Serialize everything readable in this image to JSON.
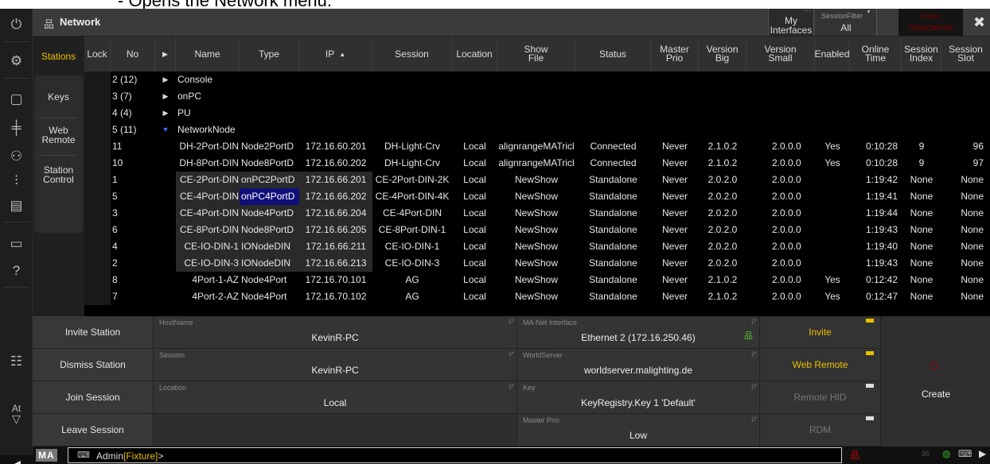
{
  "caption": {
    "text": "- Opens the Network menu."
  },
  "window": {
    "title": "Network",
    "icon": "network-icon"
  },
  "header": {
    "my_interfaces": "My Interfaces",
    "session_filter_label": "SessionFilter",
    "session_filter_value": "All",
    "status_label": "Status",
    "status_value": "Standalone"
  },
  "side": {
    "tab": "Stations",
    "items": [
      "Keys",
      "Web Remote",
      "Station Control"
    ]
  },
  "rail": {
    "at_label": "At"
  },
  "columns": {
    "stations": "Stations",
    "lock": "Lock",
    "no": "No",
    "name": "Name",
    "type": "Type",
    "ip": "IP",
    "session": "Session",
    "location": "Location",
    "show_file": "Show File",
    "status": "Status",
    "master_prio": "Master Prio",
    "version_big": "Version Big",
    "version_small": "Version Small",
    "enabled": "Enabled",
    "online_time": "Online Time",
    "session_index": "Session Index",
    "session_slot": "Session Slot"
  },
  "groups": [
    {
      "no": "2 (12)",
      "name": "Console",
      "expanded": false
    },
    {
      "no": "3 (7)",
      "name": "onPC",
      "expanded": false
    },
    {
      "no": "4 (4)",
      "name": "PU",
      "expanded": false
    },
    {
      "no": "5 (11)",
      "name": "NetworkNode",
      "expanded": true
    }
  ],
  "stations": [
    {
      "no": "11",
      "name": "DH-2Port-DIN",
      "type": "Node2PortD",
      "ip": "172.16.60.201",
      "session": "DH-Light-Crv",
      "location": "Local",
      "show": "alignrangeMATricl",
      "status": "Connected",
      "prio": "Never",
      "vbig": "2.1.0.2",
      "vsmall": "2.0.0.0",
      "enabled": "Yes",
      "online": "0:10:28",
      "sindex": "9",
      "sslot": "96",
      "shaded": false,
      "selected": false
    },
    {
      "no": "10",
      "name": "DH-8Port-DIN",
      "type": "Node8PortD",
      "ip": "172.16.60.202",
      "session": "DH-Light-Crv",
      "location": "Local",
      "show": "alignrangeMATricl",
      "status": "Connected",
      "prio": "Never",
      "vbig": "2.1.0.2",
      "vsmall": "2.0.0.0",
      "enabled": "Yes",
      "online": "0:10:28",
      "sindex": "9",
      "sslot": "97",
      "shaded": false,
      "selected": false
    },
    {
      "no": "1",
      "name": "CE-2Port-DIN",
      "type": "onPC2PortD",
      "ip": "172.16.66.201",
      "session": "CE-2Port-DIN-2K",
      "location": "Local",
      "show": "NewShow",
      "status": "Standalone",
      "prio": "Never",
      "vbig": "2.0.2.0",
      "vsmall": "2.0.0.0",
      "enabled": "",
      "online": "1:19:42",
      "sindex": "None",
      "sslot": "None",
      "shaded": true,
      "selected": false
    },
    {
      "no": "5",
      "name": "CE-4Port-DIN",
      "type": "onPC4PortD",
      "ip": "172.16.66.202",
      "session": "CE-4Port-DIN-4K",
      "location": "Local",
      "show": "NewShow",
      "status": "Standalone",
      "prio": "Never",
      "vbig": "2.0.2.0",
      "vsmall": "2.0.0.0",
      "enabled": "",
      "online": "1:19:41",
      "sindex": "None",
      "sslot": "None",
      "shaded": true,
      "selected": true
    },
    {
      "no": "3",
      "name": "CE-4Port-DIN",
      "type": "Node4PortD",
      "ip": "172.16.66.204",
      "session": "CE-4Port-DIN",
      "location": "Local",
      "show": "NewShow",
      "status": "Standalone",
      "prio": "Never",
      "vbig": "2.0.2.0",
      "vsmall": "2.0.0.0",
      "enabled": "",
      "online": "1:19:44",
      "sindex": "None",
      "sslot": "None",
      "shaded": true,
      "selected": false
    },
    {
      "no": "6",
      "name": "CE-8Port-DIN",
      "type": "Node8PortD",
      "ip": "172.16.66.205",
      "session": "CE-8Port-DIN-1",
      "location": "Local",
      "show": "NewShow",
      "status": "Standalone",
      "prio": "Never",
      "vbig": "2.0.2.0",
      "vsmall": "2.0.0.0",
      "enabled": "",
      "online": "1:19:43",
      "sindex": "None",
      "sslot": "None",
      "shaded": true,
      "selected": false
    },
    {
      "no": "4",
      "name": "CE-IO-DIN-1",
      "type": "IONodeDIN",
      "ip": "172.16.66.211",
      "session": "CE-IO-DIN-1",
      "location": "Local",
      "show": "NewShow",
      "status": "Standalone",
      "prio": "Never",
      "vbig": "2.0.2.0",
      "vsmall": "2.0.0.0",
      "enabled": "",
      "online": "1:19:40",
      "sindex": "None",
      "sslot": "None",
      "shaded": true,
      "selected": false
    },
    {
      "no": "2",
      "name": "CE-IO-DIN-3",
      "type": "IONodeDIN",
      "ip": "172.16.66.213",
      "session": "CE-IO-DIN-3",
      "location": "Local",
      "show": "NewShow",
      "status": "Standalone",
      "prio": "Never",
      "vbig": "2.0.2.0",
      "vsmall": "2.0.0.0",
      "enabled": "",
      "online": "1:19:43",
      "sindex": "None",
      "sslot": "None",
      "shaded": true,
      "selected": false
    },
    {
      "no": "8",
      "name": "4Port-1-AZ",
      "type": "Node4Port",
      "ip": "172.16.70.101",
      "session": "AG",
      "location": "Local",
      "show": "NewShow",
      "status": "Standalone",
      "prio": "Never",
      "vbig": "2.1.0.2",
      "vsmall": "2.0.0.0",
      "enabled": "Yes",
      "online": "0:12:42",
      "sindex": "None",
      "sslot": "None",
      "shaded": false,
      "selected": false
    },
    {
      "no": "7",
      "name": "4Port-2-AZ",
      "type": "Node4Port",
      "ip": "172.16.70.102",
      "session": "AG",
      "location": "Local",
      "show": "NewShow",
      "status": "Standalone",
      "prio": "Never",
      "vbig": "2.1.0.2",
      "vsmall": "2.0.0.0",
      "enabled": "Yes",
      "online": "0:12:47",
      "sindex": "None",
      "sslot": "None",
      "shaded": false,
      "selected": false
    }
  ],
  "actions": {
    "invite_station": "Invite Station",
    "dismiss_station": "Dismiss Station",
    "join_session": "Join Session",
    "leave_session": "Leave Session"
  },
  "fields": {
    "hostname_label": "HostName",
    "hostname_value": "KevinR-PC",
    "session_label": "Session",
    "session_value": "KevinR-PC",
    "location_label": "Location",
    "location_value": "Local",
    "manet_label": "MA-Net Interface",
    "manet_value": "Ethernet 2 (172.16.250.46)",
    "worldserver_label": "WorldServer",
    "worldserver_value": "worldserver.malighting.de",
    "key_label": "Key",
    "key_value": "KeyRegistry.Key 1 'Default'",
    "masterprio_label": "Master Prio",
    "masterprio_value": "Low"
  },
  "options": {
    "invite": "Invite",
    "web_remote": "Web Remote",
    "remote_hid": "Remote HID",
    "rdm": "RDM"
  },
  "create": "Create",
  "command": {
    "logo": "MA",
    "prompt_user": "Admin",
    "prompt_context": "[Fixture]",
    "prompt_suffix": ">"
  },
  "colors": {
    "accent": "#e8c000",
    "selection": "#0f0f7a",
    "status_red": "#7a0000",
    "network_green": "#5cbf2a"
  }
}
